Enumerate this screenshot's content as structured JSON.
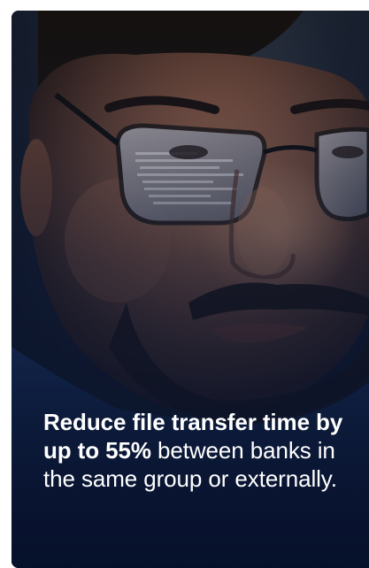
{
  "card": {
    "headline_bold": "Reduce file transfer time by up to 55%",
    "headline_rest": " between banks in the same group or externally."
  }
}
